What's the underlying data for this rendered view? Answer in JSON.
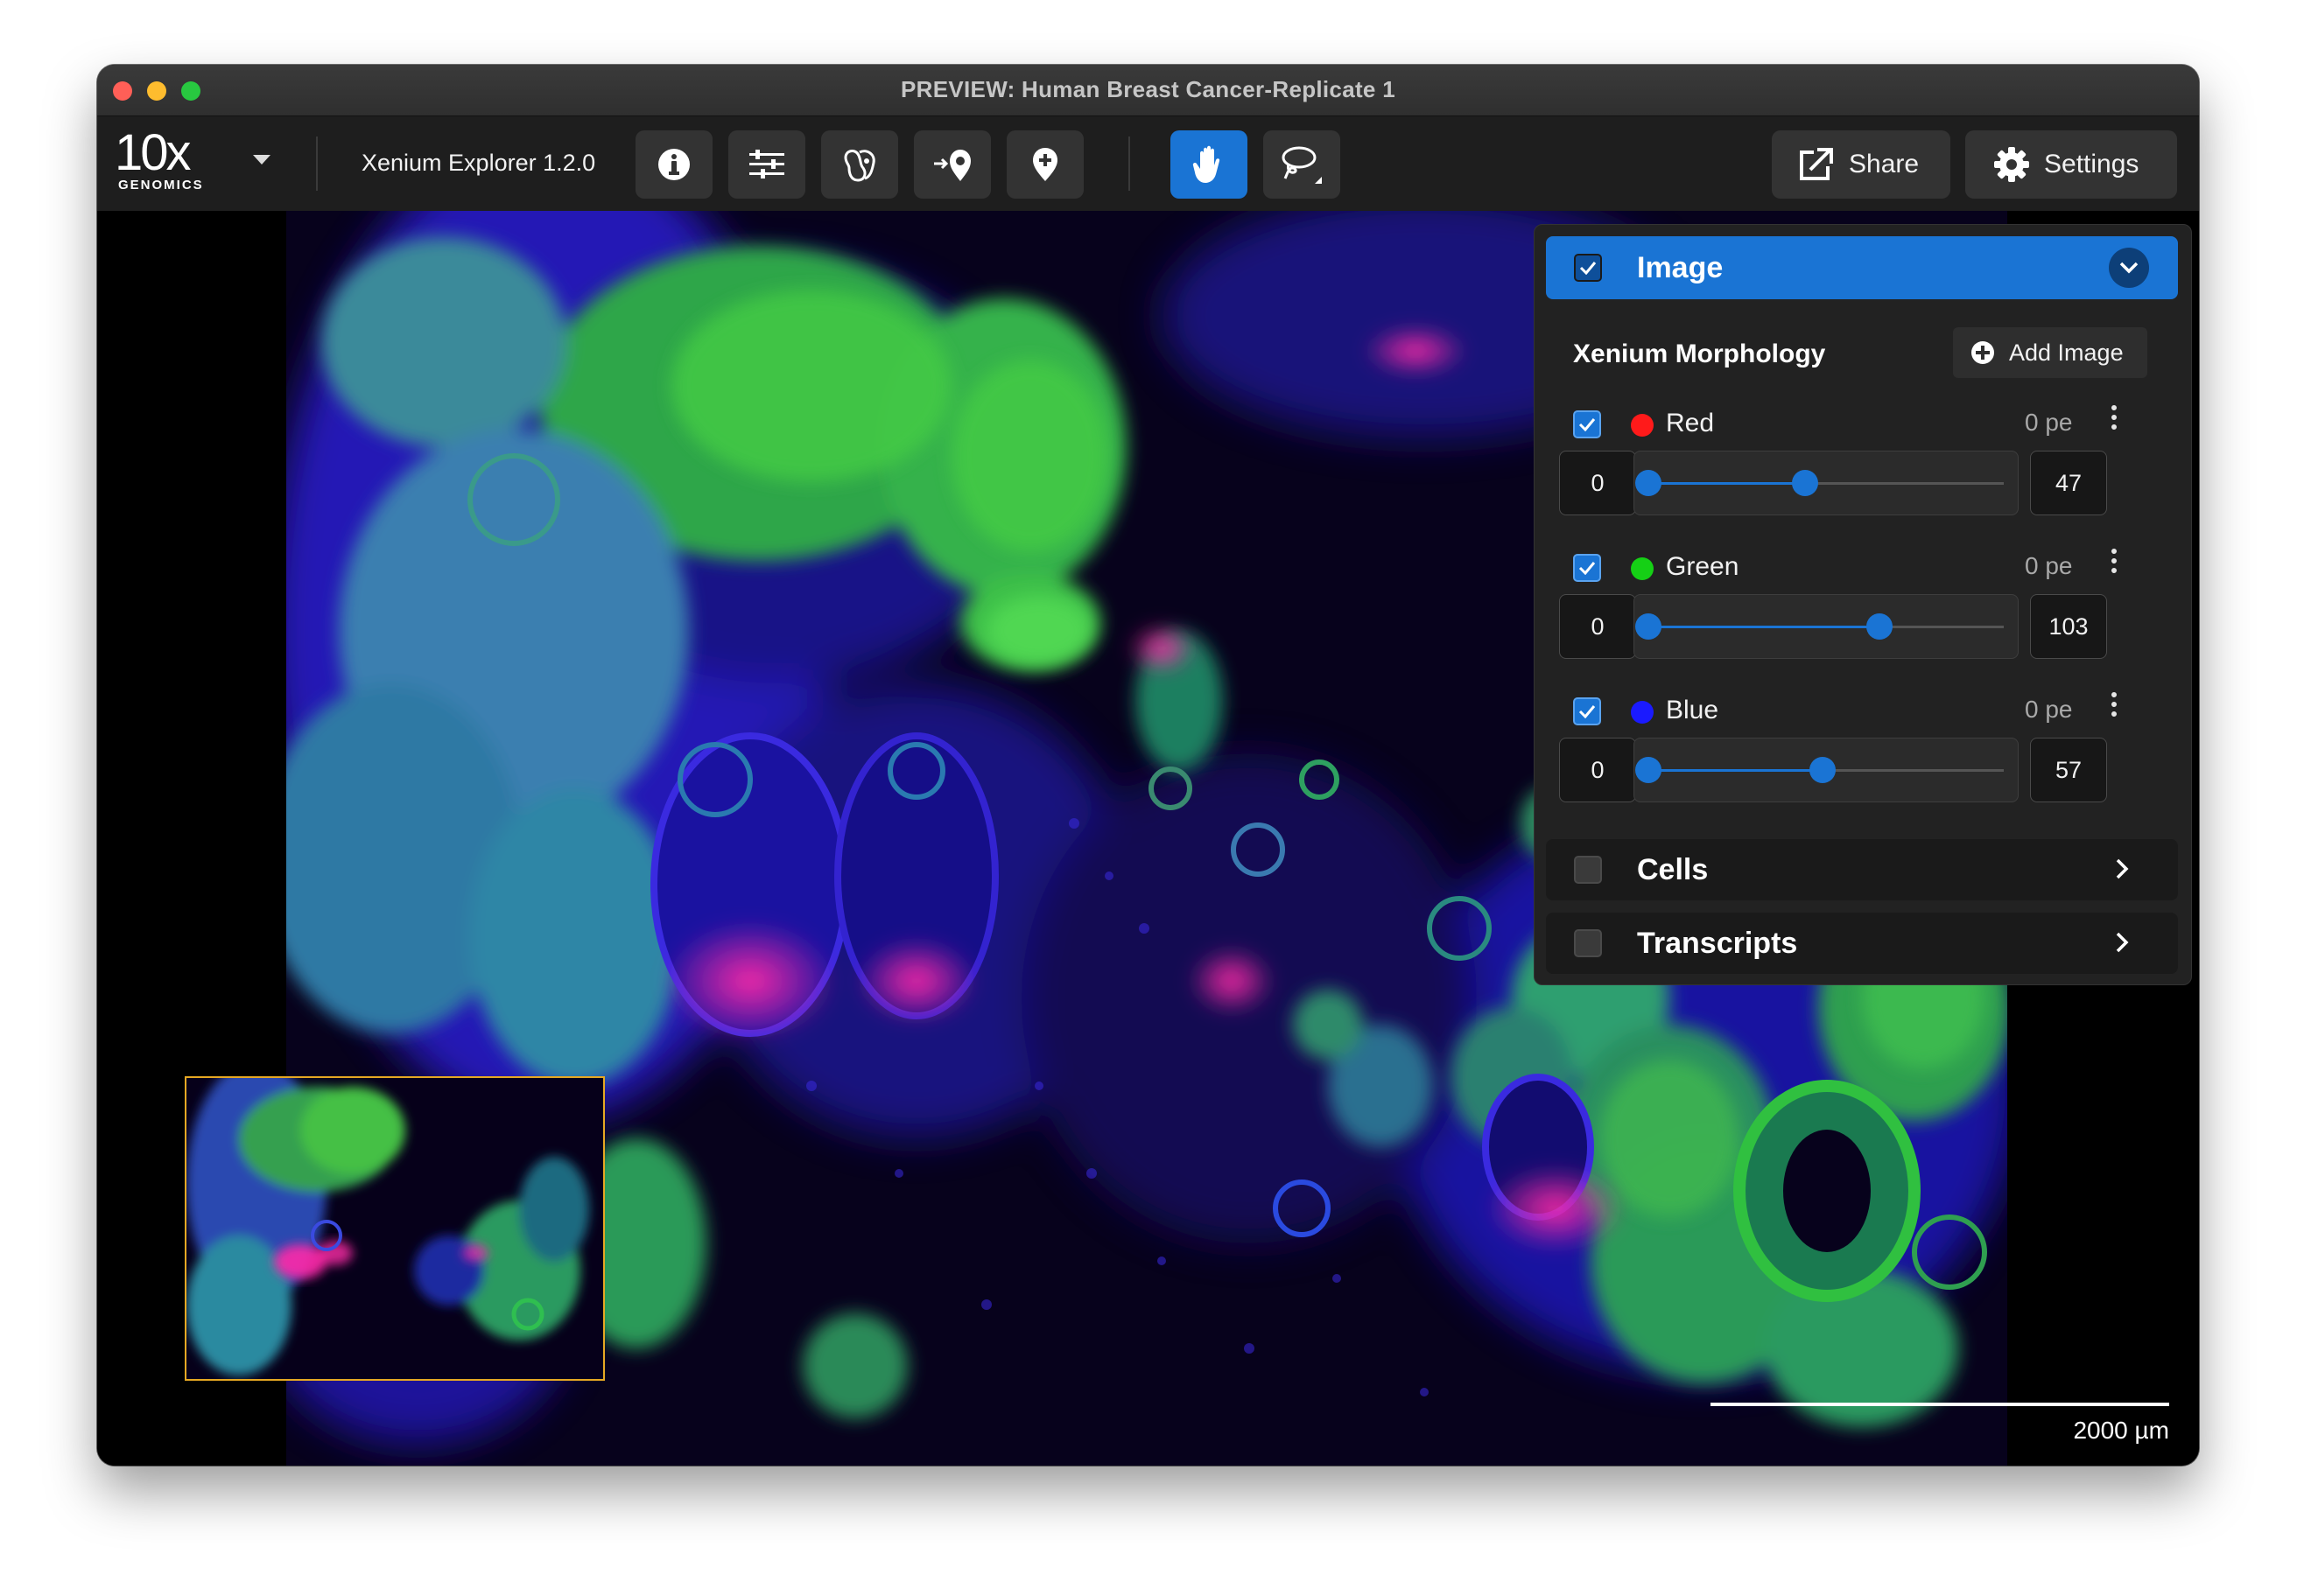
{
  "window": {
    "title": "PREVIEW: Human Breast Cancer-Replicate 1"
  },
  "toolbar": {
    "logo_text": "10x",
    "logo_subtext": "GENOMICS",
    "app_version": "Xenium Explorer 1.2.0",
    "share_label": "Share",
    "settings_label": "Settings",
    "icons": [
      "info-icon",
      "sliders-icon",
      "cell-segmentation-icon",
      "add-location-icon",
      "location-pin-icon",
      "hand-pan-icon",
      "lasso-icon",
      "share-icon",
      "gear-icon"
    ],
    "active_tool": "hand-pan-icon",
    "accent_color": "#1a74d4"
  },
  "panel": {
    "image_section": {
      "title": "Image",
      "checked": true
    },
    "morphology_title": "Xenium Morphology",
    "add_image_label": "Add Image",
    "channels": [
      {
        "name": "Red",
        "color": "#ff1a1a",
        "checked": true,
        "pe": "0 pe",
        "min": "0",
        "max": "47",
        "thumb_fraction": 0.44
      },
      {
        "name": "Green",
        "color": "#15d015",
        "checked": true,
        "pe": "0 pe",
        "min": "0",
        "max": "103",
        "thumb_fraction": 0.65
      },
      {
        "name": "Blue",
        "color": "#1a1aff",
        "checked": true,
        "pe": "0 pe",
        "min": "0",
        "max": "57",
        "thumb_fraction": 0.49
      }
    ],
    "cells_section": {
      "title": "Cells",
      "checked": false
    },
    "transcripts_section": {
      "title": "Transcripts",
      "checked": false
    }
  },
  "scalebar": {
    "label": "2000  µm"
  }
}
